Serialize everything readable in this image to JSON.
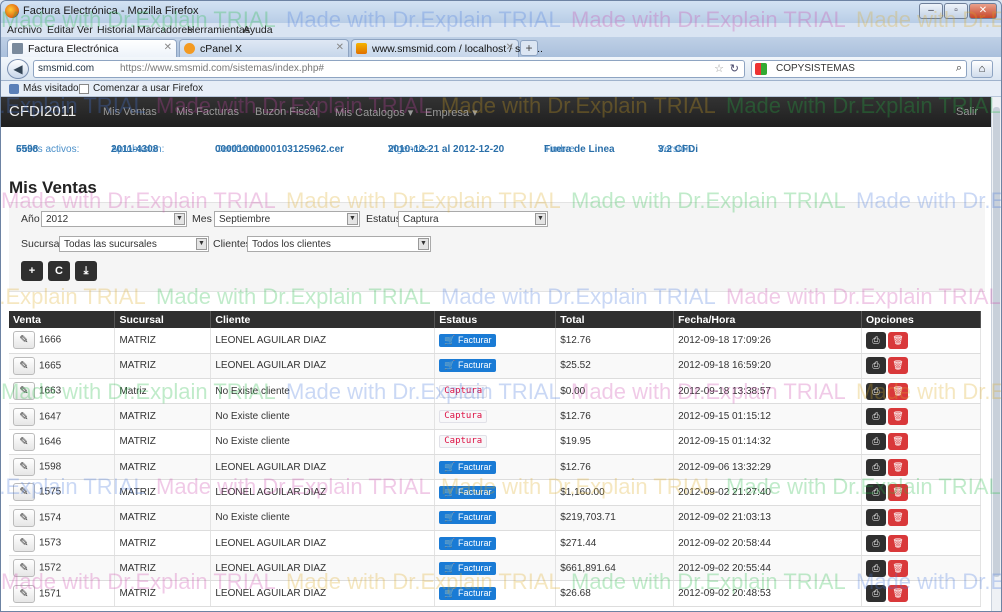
{
  "window": {
    "title": "Factura Electrónica - Mozilla Firefox",
    "menu": [
      "Archivo",
      "Editar",
      "Ver",
      "Historial",
      "Marcadores",
      "Herramientas",
      "Ayuda"
    ],
    "tabs": [
      {
        "label": "Factura Electrónica",
        "icon": "page-icon",
        "active": true
      },
      {
        "label": "cPanel X",
        "icon": "cpanel-icon",
        "active": false
      },
      {
        "label": "www.smsmid.com / localhost / sms...",
        "icon": "phpmyadmin-icon",
        "active": false
      }
    ],
    "new_tab": "+",
    "address": {
      "site": "smsmid.com",
      "url": "https://www.smsmid.com/sistemas/index.php#"
    },
    "search": {
      "engine": "COPYSISTEMAS"
    },
    "bookmarks": [
      "Más visitados",
      "Comenzar a usar Firefox"
    ]
  },
  "app": {
    "brand": "CFDI2011",
    "nav": [
      "Mis Ventas",
      "Mis Facturas",
      "Buzon Fiscal",
      "Mis Catalogos ▾",
      "Empresa ▾"
    ],
    "logout": "Salir",
    "info": {
      "folios_label": "Folios activos:",
      "folios_value": "6598",
      "aprob_label": "Aprobacion:",
      "aprob_value": "2011-4308",
      "cert_label": "Certificado:",
      "cert_value": "00001000000103125962.cer",
      "vig_label": "Vigencia:",
      "vig_value": "2010-12-21 al 2012-12-20",
      "timbre_label": "Timbre:",
      "timbre_value": "Fuera de Linea",
      "version_label": "Versión:",
      "version_value": "3.2 CFDi"
    },
    "page_title": "Mis Ventas",
    "filters": {
      "year_label": "Año",
      "year_value": "2012",
      "month_label": "Mes",
      "month_value": "Septiembre",
      "status_label": "Estatus",
      "status_value": "Captura",
      "branch_label": "Sucursal",
      "branch_value": "Todas las sucursales",
      "client_label": "Clientes",
      "client_value": "Todos los clientes"
    },
    "actions": {
      "add": "+",
      "refresh": "C",
      "download": "⤓"
    }
  },
  "table": {
    "headers": [
      "Venta",
      "Sucursal",
      "Cliente",
      "Estatus",
      "Total",
      "Fecha/Hora",
      "Opciones"
    ],
    "facturar_label": "Facturar",
    "captura_label": "Captura",
    "rows": [
      {
        "venta": "1666",
        "sucursal": "MATRIZ",
        "cliente": "LEONEL AGUILAR DIAZ",
        "estatus": "Facturar",
        "total": "$12.76",
        "fecha": "2012-09-18 17:09:26"
      },
      {
        "venta": "1665",
        "sucursal": "MATRIZ",
        "cliente": "LEONEL AGUILAR DIAZ",
        "estatus": "Facturar",
        "total": "$25.52",
        "fecha": "2012-09-18 16:59:20"
      },
      {
        "venta": "1663",
        "sucursal": "Matriz",
        "cliente": "No Existe cliente",
        "estatus": "Captura",
        "total": "$0.00",
        "fecha": "2012-09-18 13:38:57"
      },
      {
        "venta": "1647",
        "sucursal": "MATRIZ",
        "cliente": "No Existe cliente",
        "estatus": "Captura",
        "total": "$12.76",
        "fecha": "2012-09-15 01:15:12"
      },
      {
        "venta": "1646",
        "sucursal": "MATRIZ",
        "cliente": "No Existe cliente",
        "estatus": "Captura",
        "total": "$19.95",
        "fecha": "2012-09-15 01:14:32"
      },
      {
        "venta": "1598",
        "sucursal": "MATRIZ",
        "cliente": "LEONEL AGUILAR DIAZ",
        "estatus": "Facturar",
        "total": "$12.76",
        "fecha": "2012-09-06 13:32:29"
      },
      {
        "venta": "1575",
        "sucursal": "MATRIZ",
        "cliente": "LEONEL AGUILAR DIAZ",
        "estatus": "Facturar",
        "total": "$1,160.00",
        "fecha": "2012-09-02 21:27:40"
      },
      {
        "venta": "1574",
        "sucursal": "MATRIZ",
        "cliente": "No Existe cliente",
        "estatus": "Facturar",
        "total": "$219,703.71",
        "fecha": "2012-09-02 21:03:13"
      },
      {
        "venta": "1573",
        "sucursal": "MATRIZ",
        "cliente": "LEONEL AGUILAR DIAZ",
        "estatus": "Facturar",
        "total": "$271.44",
        "fecha": "2012-09-02 20:58:44"
      },
      {
        "venta": "1572",
        "sucursal": "MATRIZ",
        "cliente": "LEONEL AGUILAR DIAZ",
        "estatus": "Facturar",
        "total": "$661,891.64",
        "fecha": "2012-09-02 20:55:44"
      },
      {
        "venta": "1571",
        "sucursal": "MATRIZ",
        "cliente": "LEONEL AGUILAR DIAZ",
        "estatus": "Facturar",
        "total": "$26.68",
        "fecha": "2012-09-02 20:48:53"
      }
    ]
  },
  "watermark": "Made with Dr.Explain TRIAL",
  "colors": {
    "navbar": "#222222",
    "info_text": "#2a6fa9",
    "facturar_badge": "#1a7bd5",
    "captura_text": "#dd1144",
    "delete_button": "#d9383a"
  }
}
